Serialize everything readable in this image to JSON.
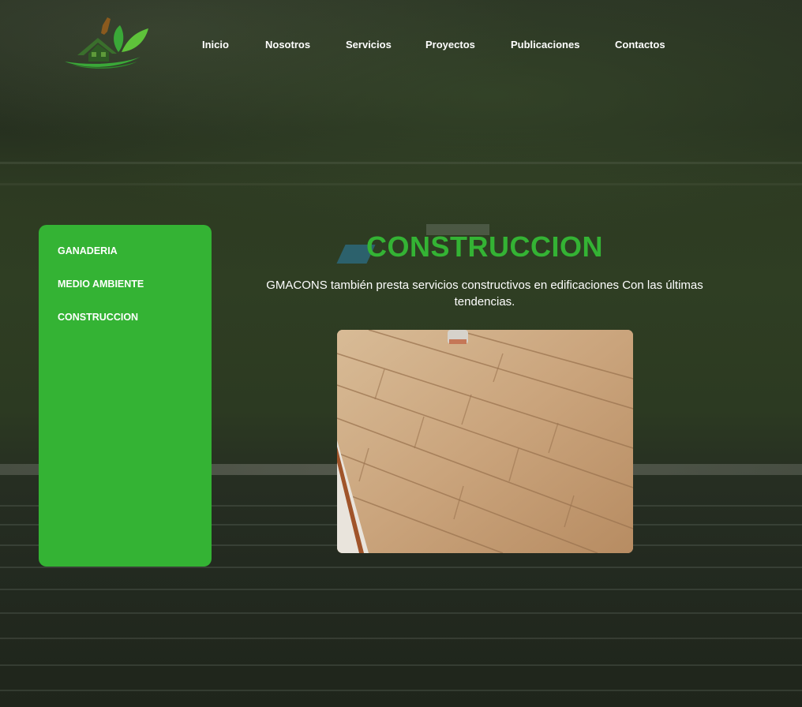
{
  "brand": {
    "logo_icon": "house-leaves-logo",
    "colors": {
      "accent": "#34b334",
      "logo_brown": "#8a5a1e",
      "logo_green": "#3aa838"
    }
  },
  "nav": {
    "items": [
      "Inicio",
      "Nosotros",
      "Servicios",
      "Proyectos",
      "Publicaciones",
      "Contactos"
    ]
  },
  "sidebar": {
    "items": [
      "GANADERIA",
      "MEDIO AMBIENTE",
      "CONSTRUCCION"
    ]
  },
  "main": {
    "title": "CONSTRUCCION",
    "description": "GMACONS también presta servicios constructivos en edificaciones Con las últimas tendencias.",
    "image_icon": "wood-floor-photo"
  }
}
